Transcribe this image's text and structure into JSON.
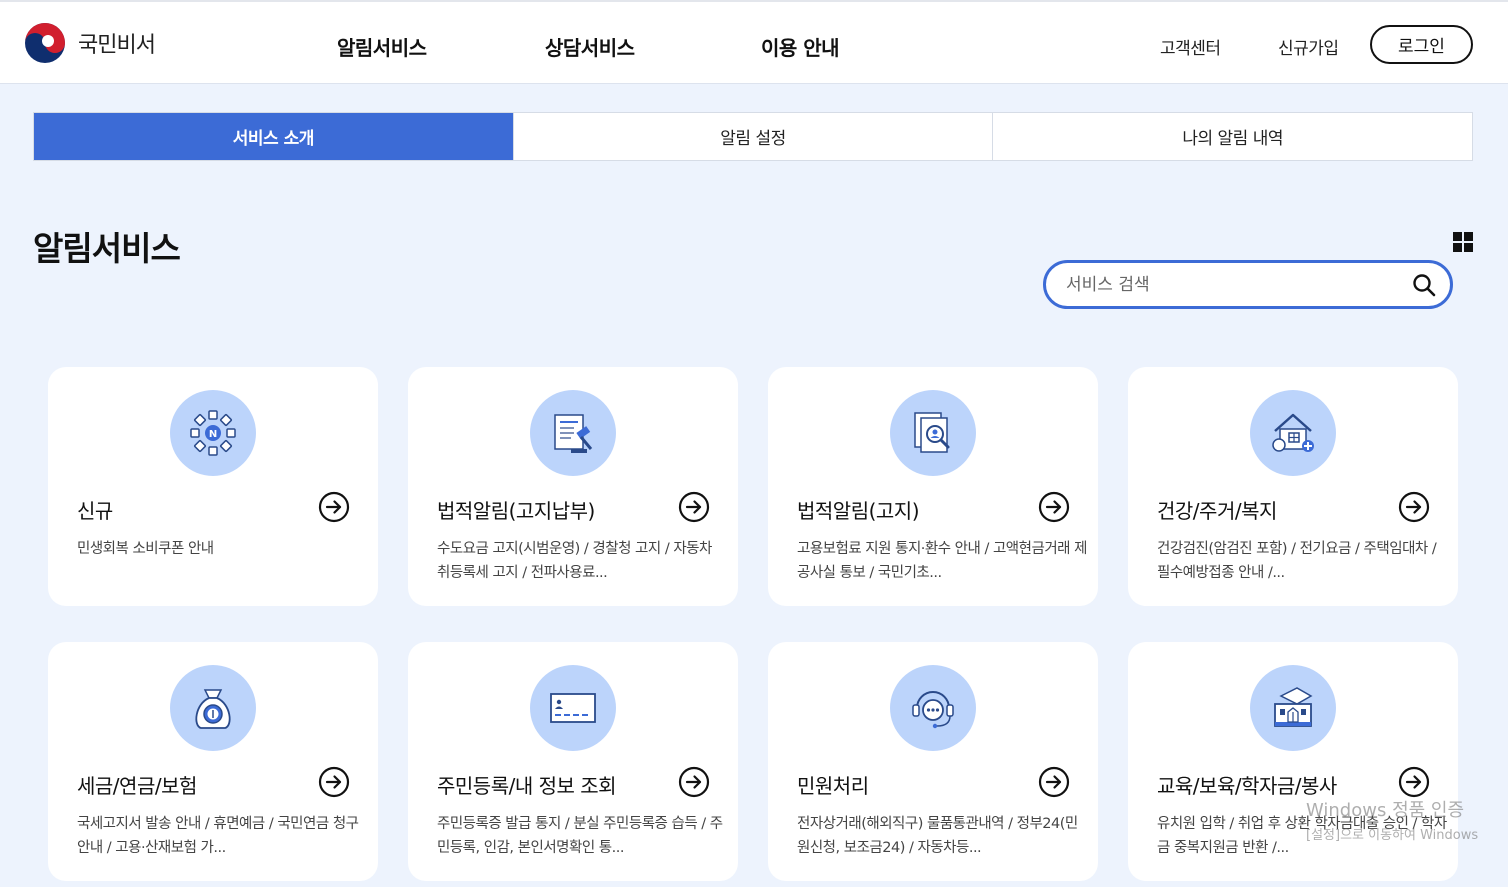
{
  "header": {
    "logo_text": "국민비서",
    "nav": [
      "알림서비스",
      "상담서비스",
      "이용 안내"
    ],
    "util": [
      "고객센터",
      "신규가입"
    ],
    "login_label": "로그인"
  },
  "tabs": [
    {
      "label": "서비스 소개",
      "active": true
    },
    {
      "label": "알림 설정",
      "active": false
    },
    {
      "label": "나의 알림 내역",
      "active": false
    }
  ],
  "main": {
    "title": "알림서비스",
    "search_placeholder": "서비스 검색"
  },
  "cards": [
    {
      "title": "신규",
      "desc": "민생회복 소비쿠폰 안내",
      "icon": "new-icon"
    },
    {
      "title": "법적알림(고지납부)",
      "desc": "수도요금 고지(시범운영)  / 경찰청 고지  / 자동차 취등록세 고지  / 전파사용료...",
      "icon": "legal-payment-icon"
    },
    {
      "title": "법적알림(고지)",
      "desc": "고용보험료 지원 통지·환수 안내  / 고액현금거래 제공사실 통보  / 국민기초...",
      "icon": "legal-notice-icon"
    },
    {
      "title": "건강/주거/복지",
      "desc": "건강검진(암검진 포함)  / 전기요금  / 주택임대차  / 필수예방접종 안내  /...",
      "icon": "health-housing-icon"
    },
    {
      "title": "세금/연금/보험",
      "desc": "국세고지서 발송 안내  / 휴면예금  / 국민연금 청구안내  / 고용·산재보험 가...",
      "icon": "money-bag-icon"
    },
    {
      "title": "주민등록/내 정보 조회",
      "desc": "주민등록증 발급 통지  / 분실 주민등록증 습득  / 주민등록, 인감, 본인서명확인 통...",
      "icon": "id-card-icon"
    },
    {
      "title": "민원처리",
      "desc": "전자상거래(해외직구) 물품통관내역  / 정부24(민원신청, 보조금24)  / 자동차등...",
      "icon": "headset-icon"
    },
    {
      "title": "교육/보육/학자금/봉사",
      "desc": "유치원 입학  / 취업 후 상환 학자금대출 승인  / 학자금 중복지원금 반환  /...",
      "icon": "school-icon"
    }
  ],
  "watermark": {
    "title": "Windows 정품 인증",
    "subtitle": "[설정]으로 이동하여 Windows"
  },
  "colors": {
    "accent": "#3c6bd6",
    "background": "#edf3fd",
    "icon_circle": "#bcd4fb"
  }
}
